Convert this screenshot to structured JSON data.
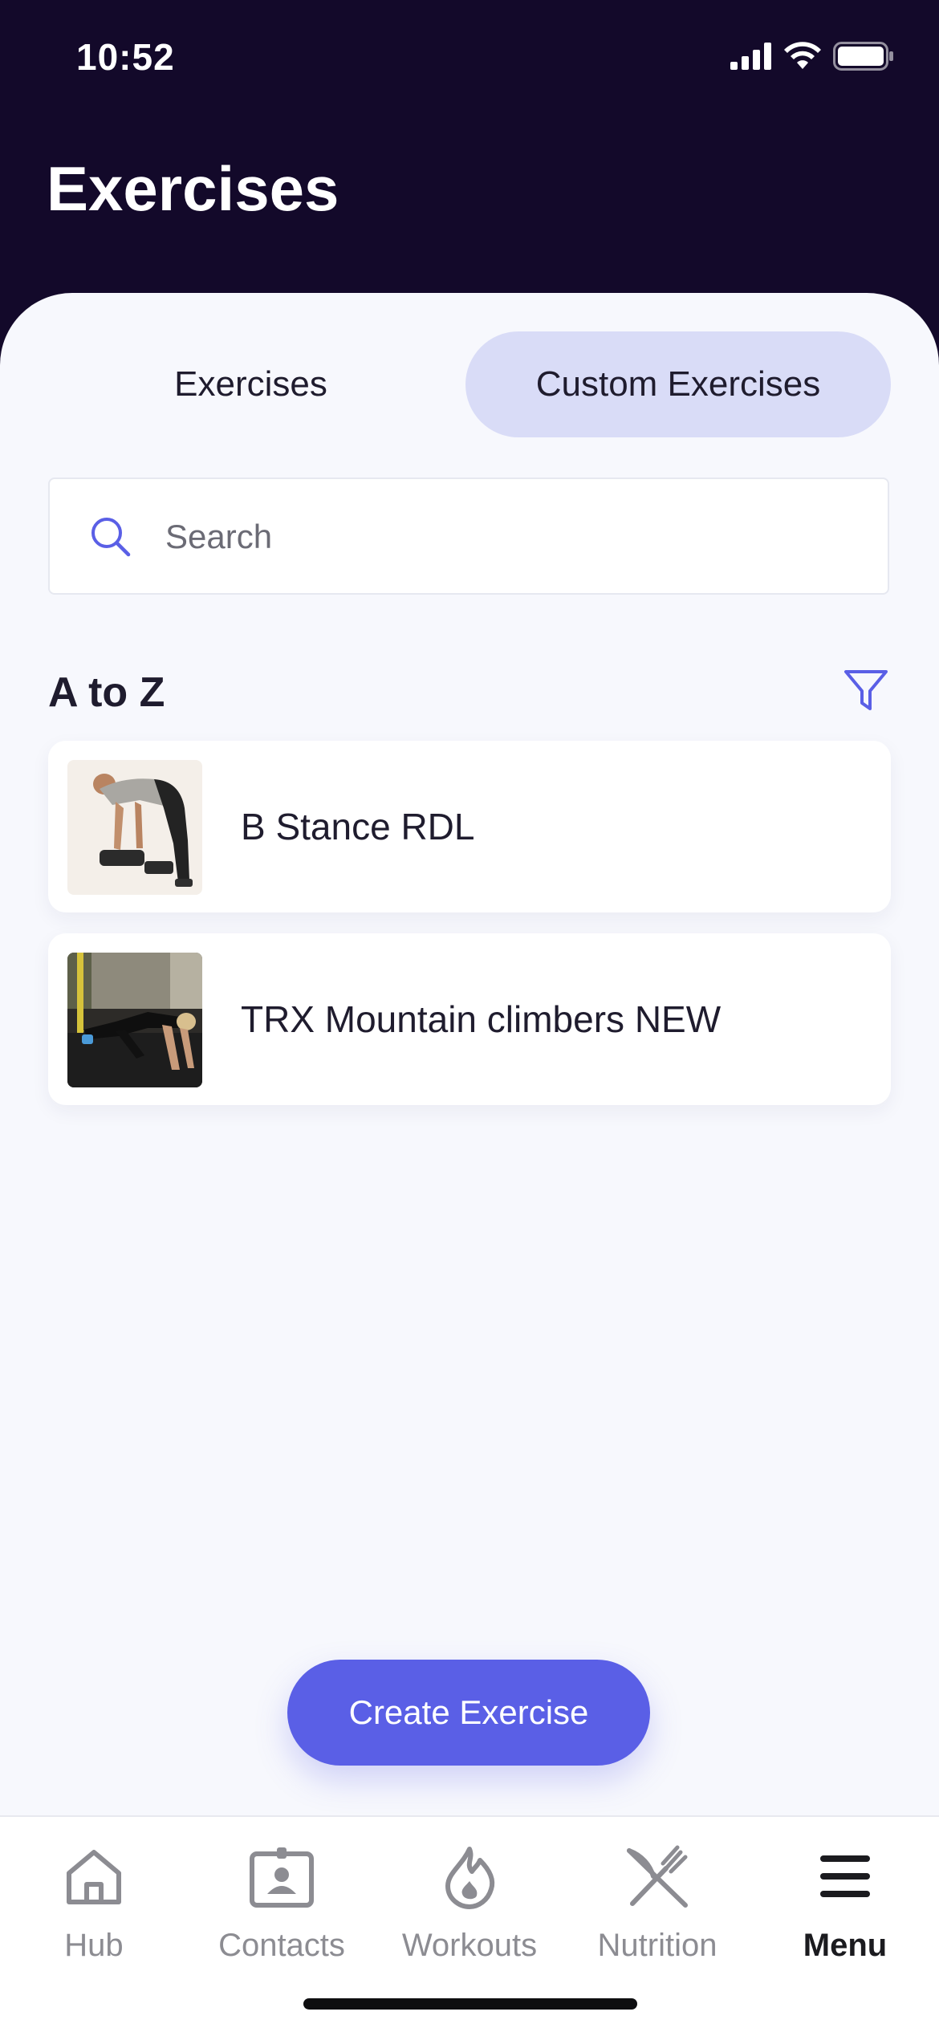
{
  "status_bar": {
    "time": "10:52"
  },
  "header": {
    "title": "Exercises"
  },
  "tabs": [
    {
      "label": "Exercises",
      "selected": false
    },
    {
      "label": "Custom Exercises",
      "selected": true
    }
  ],
  "search": {
    "placeholder": "Search",
    "value": ""
  },
  "section": {
    "title": "A to Z"
  },
  "exercises": [
    {
      "name": "B Stance RDL"
    },
    {
      "name": "TRX Mountain climbers NEW"
    }
  ],
  "create_button": {
    "label": "Create Exercise"
  },
  "bottom_nav": {
    "items": [
      {
        "label": "Hub",
        "icon": "home-icon",
        "active": false
      },
      {
        "label": "Contacts",
        "icon": "contact-card-icon",
        "active": false
      },
      {
        "label": "Workouts",
        "icon": "flame-icon",
        "active": false
      },
      {
        "label": "Nutrition",
        "icon": "fork-knife-icon",
        "active": false
      },
      {
        "label": "Menu",
        "icon": "hamburger-menu-icon",
        "active": true
      }
    ]
  },
  "colors": {
    "header_bg": "#13092a",
    "accent": "#5a5fe6",
    "tab_selected_bg": "#d9dcf7",
    "content_bg": "#f7f8fd"
  }
}
